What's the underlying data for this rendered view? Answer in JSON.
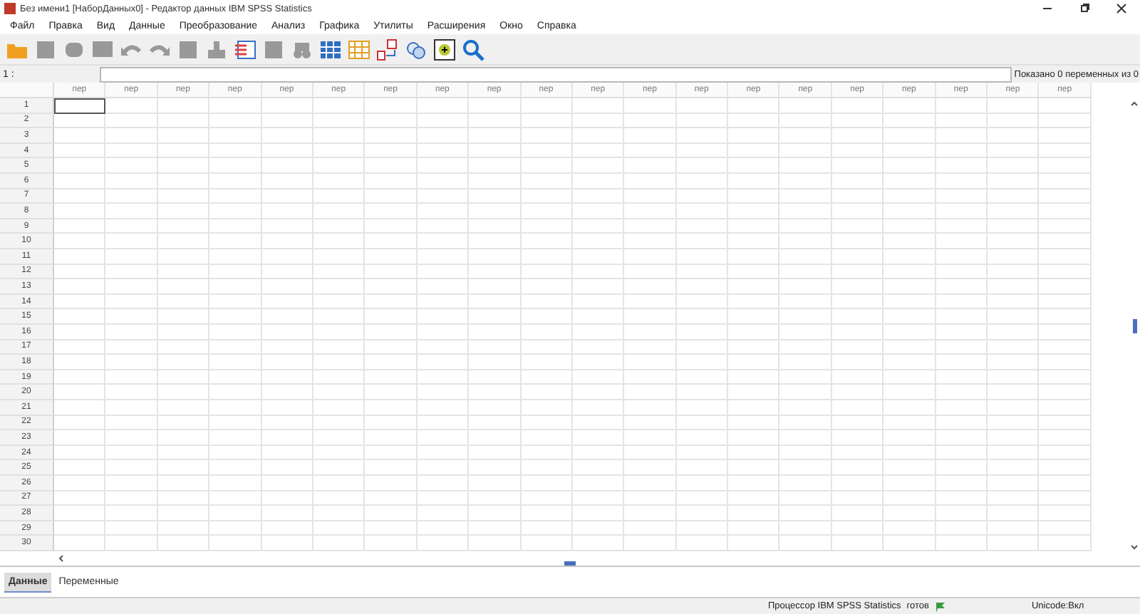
{
  "window": {
    "title": "Без имени1 [НаборДанных0] - Редактор данных IBM SPSS Statistics"
  },
  "menu": [
    "Файл",
    "Правка",
    "Вид",
    "Данные",
    "Преобразование",
    "Анализ",
    "Графика",
    "Утилиты",
    "Расширения",
    "Окно",
    "Справка"
  ],
  "cell_editor": {
    "cell_ref": "1 :",
    "variables_shown": "Показано 0 переменных из 0"
  },
  "grid": {
    "columns": [
      "пер",
      "пер",
      "пер",
      "пер",
      "пер",
      "пер",
      "пер",
      "пер",
      "пер",
      "пер",
      "пер",
      "пер",
      "пер",
      "пер",
      "пер",
      "пер",
      "пер",
      "пер",
      "пер",
      "пер"
    ],
    "rows": [
      {
        "label": "1",
        "selected": true
      },
      {
        "label": "2",
        "selected": false
      },
      {
        "label": "3",
        "selected": false
      },
      {
        "label": "4",
        "selected": false
      },
      {
        "label": "5",
        "selected": false
      },
      {
        "label": "6",
        "selected": false
      },
      {
        "label": "7",
        "selected": false
      },
      {
        "label": "8",
        "selected": false
      },
      {
        "label": "9",
        "selected": false
      },
      {
        "label": "10",
        "selected": false
      },
      {
        "label": "11",
        "selected": false
      },
      {
        "label": "12",
        "selected": false
      },
      {
        "label": "13",
        "selected": false
      },
      {
        "label": "14",
        "selected": false
      },
      {
        "label": "15",
        "selected": false
      },
      {
        "label": "16",
        "selected": false
      },
      {
        "label": "17",
        "selected": false
      },
      {
        "label": "18",
        "selected": false
      },
      {
        "label": "19",
        "selected": false
      },
      {
        "label": "20",
        "selected": false
      },
      {
        "label": "21",
        "selected": false
      },
      {
        "label": "22",
        "selected": false
      },
      {
        "label": "23",
        "selected": false
      },
      {
        "label": "24",
        "selected": false
      },
      {
        "label": "25",
        "selected": false
      },
      {
        "label": "26",
        "selected": false
      },
      {
        "label": "27",
        "selected": false
      },
      {
        "label": "28",
        "selected": false
      },
      {
        "label": "29",
        "selected": false
      },
      {
        "label": "30",
        "selected": false
      }
    ]
  },
  "tabs": [
    {
      "label": "Данные",
      "selected": true
    },
    {
      "label": "Переменные",
      "selected": false
    }
  ],
  "status_bar": {
    "processor": "Процессор IBM SPSS Statistics",
    "state": "готов",
    "unicode": "Unicode:Вкл"
  }
}
